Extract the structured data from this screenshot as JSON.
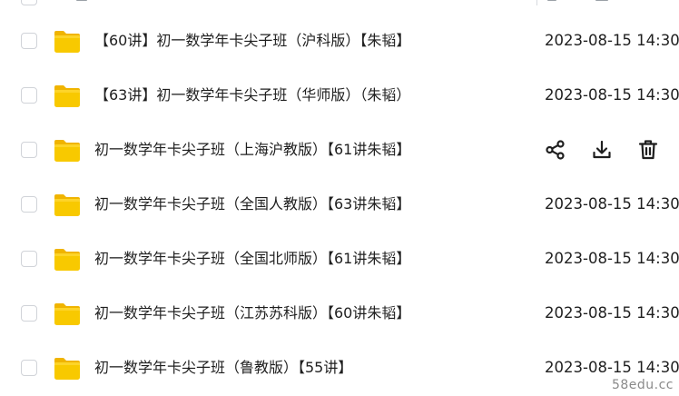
{
  "files": [
    {
      "name": "【60讲】初一数学年卡尖子班（沪科版）【朱韬】",
      "date": "2023-08-15 14:30",
      "hover": false
    },
    {
      "name": "【63讲】初一数学年卡尖子班（华师版）（朱韬）",
      "date": "2023-08-15 14:30",
      "hover": false
    },
    {
      "name": "初一数学年卡尖子班（上海沪教版）【61讲朱韬】",
      "date": "",
      "hover": true
    },
    {
      "name": "初一数学年卡尖子班（全国人教版）【63讲朱韬】",
      "date": "2023-08-15 14:30",
      "hover": false
    },
    {
      "name": "初一数学年卡尖子班（全国北师版）【61讲朱韬】",
      "date": "2023-08-15 14:30",
      "hover": false
    },
    {
      "name": "初一数学年卡尖子班（江苏苏科版）【60讲朱韬】",
      "date": "2023-08-15 14:30",
      "hover": false
    },
    {
      "name": "初一数学年卡尖子班（鲁教版）【55讲】",
      "date": "2023-08-15 14:30",
      "hover": false
    }
  ],
  "row_actions": [
    "share-icon",
    "download-icon",
    "delete-icon"
  ],
  "watermark": "58edu.cc",
  "colors": {
    "folder": "#f8c900",
    "folder_tab": "#f0b400",
    "text": "#1f1f1f",
    "checkbox_border": "#d0d3d8"
  }
}
